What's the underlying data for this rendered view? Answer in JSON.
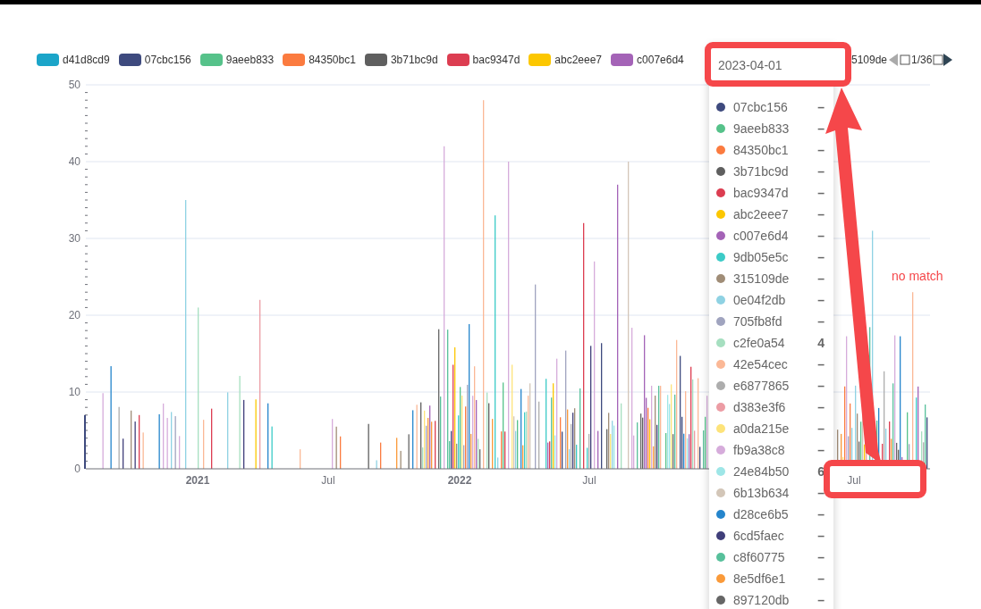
{
  "legend": {
    "items": [
      {
        "label": "d41d8cd9",
        "color": "#1ba5c9"
      },
      {
        "label": "07cbc156",
        "color": "#3e4a7e"
      },
      {
        "label": "9aeeb833",
        "color": "#56c28a"
      },
      {
        "label": "84350bc1",
        "color": "#fb7b3f"
      },
      {
        "label": "3b71bc9d",
        "color": "#5f5f5f"
      },
      {
        "label": "bac9347d",
        "color": "#dc3d51"
      },
      {
        "label": "abc2eee7",
        "color": "#fcc700"
      },
      {
        "label": "c007e6d4",
        "color": "#a463b7"
      }
    ],
    "cut_label": "5109de",
    "page": "1/36"
  },
  "chart": {
    "y_axis_labels": [
      "50",
      "40",
      "30",
      "20",
      "10",
      "0"
    ],
    "x_axis_labels": [
      {
        "label": "2021",
        "bold": true
      },
      {
        "label": "Jul",
        "bold": false
      },
      {
        "label": "2022",
        "bold": true
      },
      {
        "label": "Jul",
        "bold": false
      },
      {
        "label": "Jul",
        "bold": false
      }
    ]
  },
  "tooltip": {
    "title": "2023-04-01",
    "rows": [
      {
        "name": "07cbc156",
        "color": "#3e4a7e",
        "value": "–"
      },
      {
        "name": "9aeeb833",
        "color": "#56c28a",
        "value": "–"
      },
      {
        "name": "84350bc1",
        "color": "#fb7b3f",
        "value": "–"
      },
      {
        "name": "3b71bc9d",
        "color": "#5f5f5f",
        "value": "–"
      },
      {
        "name": "bac9347d",
        "color": "#dc3d51",
        "value": "–"
      },
      {
        "name": "abc2eee7",
        "color": "#fcc700",
        "value": "–"
      },
      {
        "name": "c007e6d4",
        "color": "#a463b7",
        "value": "–"
      },
      {
        "name": "9db05e5c",
        "color": "#3ccbc7",
        "value": "–"
      },
      {
        "name": "315109de",
        "color": "#a08d77",
        "value": "–"
      },
      {
        "name": "0e04f2db",
        "color": "#8fd2e3",
        "value": "–"
      },
      {
        "name": "705fb8fd",
        "color": "#a0a4bf",
        "value": "–"
      },
      {
        "name": "c2fe0a54",
        "color": "#a6dfc0",
        "value": "4"
      },
      {
        "name": "42e54cec",
        "color": "#fbb896",
        "value": "–"
      },
      {
        "name": "e6877865",
        "color": "#adadad",
        "value": "–"
      },
      {
        "name": "d383e3f6",
        "color": "#ec9ca4",
        "value": "–"
      },
      {
        "name": "a0da215e",
        "color": "#fde37a",
        "value": "–"
      },
      {
        "name": "fb9a38c8",
        "color": "#d6acdb",
        "value": "–"
      },
      {
        "name": "24e84b50",
        "color": "#9ee6e7",
        "value": "6"
      },
      {
        "name": "6b13b634",
        "color": "#d3c6b8",
        "value": "–"
      },
      {
        "name": "d28ce6b5",
        "color": "#2585cc",
        "value": "–"
      },
      {
        "name": "6cd5faec",
        "color": "#403f7a",
        "value": "–"
      },
      {
        "name": "c8f60775",
        "color": "#57c09b",
        "value": "–"
      },
      {
        "name": "8e5df6e1",
        "color": "#fa9a3a",
        "value": "–"
      },
      {
        "name": "897120db",
        "color": "#666666",
        "value": "–"
      }
    ]
  },
  "annotation": {
    "note": "no match"
  }
}
